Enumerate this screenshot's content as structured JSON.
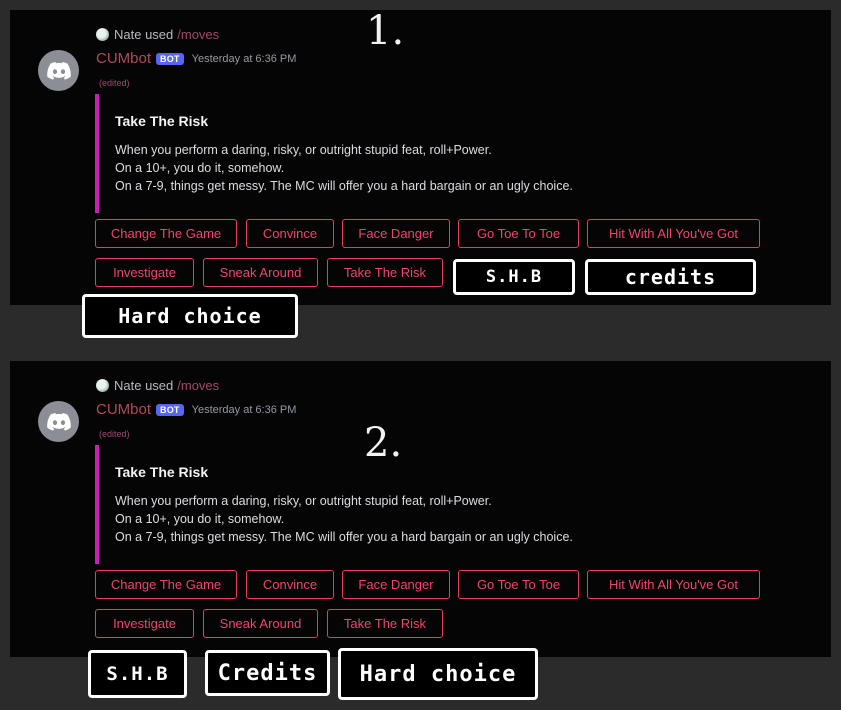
{
  "screenshots": [
    {
      "reply": {
        "user": "Nate used",
        "command": "/moves"
      },
      "bot_name": "CUMbot",
      "bot_tag": "BOT",
      "timestamp": "Yesterday at 6:36 PM",
      "edited": "(edited)",
      "embed": {
        "title": "Take The Risk",
        "lines": [
          "When you perform a daring, risky, or outright stupid feat, roll+Power.",
          "On a 10+, you do it, somehow.",
          "On a 7-9, things get messy. The MC will offer you a hard bargain or an ugly choice."
        ]
      },
      "buttons": [
        "Change The Game",
        "Convince",
        "Face Danger",
        "Go Toe To Toe",
        "Hit With All You've Got",
        "Investigate",
        "Sneak Around",
        "Take The Risk"
      ],
      "annotations": {
        "number": "1.",
        "labels": [
          "S.H.B",
          "credits",
          "Hard choice"
        ]
      }
    },
    {
      "reply": {
        "user": "Nate used",
        "command": "/moves"
      },
      "bot_name": "CUMbot",
      "bot_tag": "BOT",
      "timestamp": "Yesterday at 6:36 PM",
      "edited": "(edited)",
      "embed": {
        "title": "Take The Risk",
        "lines": [
          "When you perform a daring, risky, or outright stupid feat, roll+Power.",
          "On a 10+, you do it, somehow.",
          "On a 7-9, things get messy. The MC will offer you a hard bargain or an ugly choice."
        ]
      },
      "buttons": [
        "Change The Game",
        "Convince",
        "Face Danger",
        "Go Toe To Toe",
        "Hit With All You've Got",
        "Investigate",
        "Sneak Around",
        "Take The Risk"
      ],
      "annotations": {
        "number": "2.",
        "labels": [
          "S.H.B",
          "Credits",
          "Hard choice"
        ]
      }
    }
  ],
  "colors": {
    "button_border": "#ea3a64",
    "embed_accent": "#c91fb7",
    "bot_tag": "#5865f2",
    "username": "#b34a57"
  },
  "icons": {
    "avatar": "discord-logo-icon"
  }
}
